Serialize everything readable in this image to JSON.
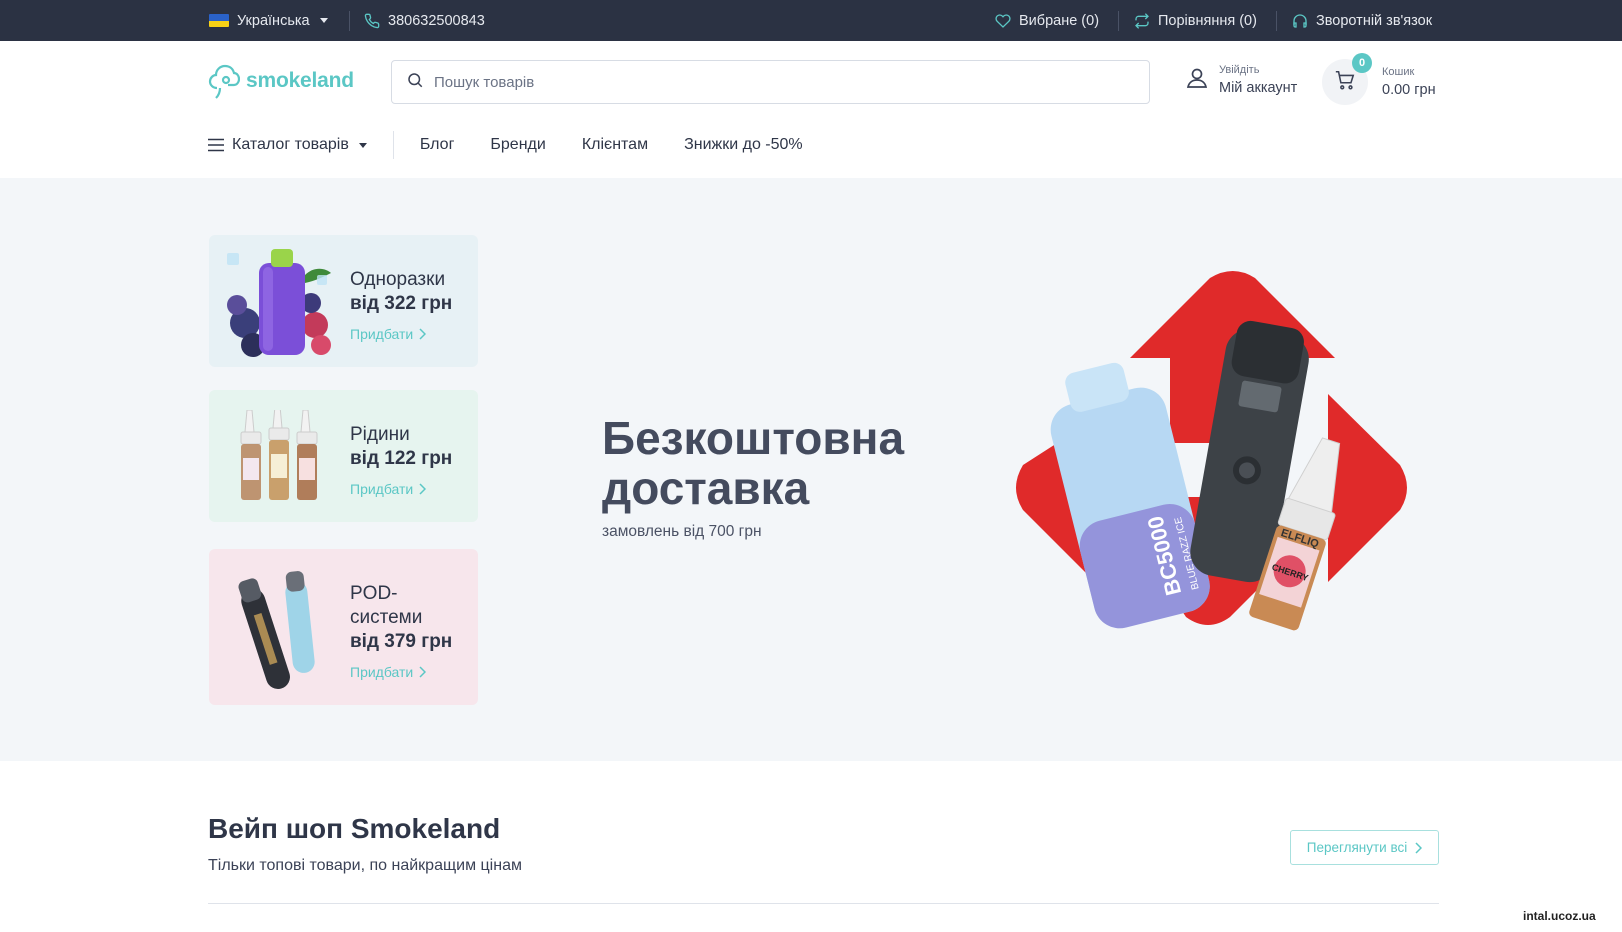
{
  "topbar": {
    "language": "Українська",
    "phone": "380632500843",
    "favorites": "Вибране (0)",
    "compare": "Порівняння (0)",
    "feedback": "Зворотній зв'язок"
  },
  "header": {
    "logo": "smokeland",
    "search_placeholder": "Пошук товарів",
    "account_small": "Увійдіть",
    "account_big": "Мій аккаунт",
    "cart_small": "Кошик",
    "cart_total": "0.00 грн",
    "cart_count": "0"
  },
  "nav": {
    "catalog": "Каталог товарів",
    "links": [
      "Блог",
      "Бренди",
      "Клієнтам",
      "Знижки до -50%"
    ]
  },
  "hero": {
    "cards": [
      {
        "name": "Одноразки",
        "price": "від 322 грн",
        "buy": "Придбати",
        "bg": "#e7f1f5"
      },
      {
        "name": "Рідини",
        "price": "від 122 грн",
        "buy": "Придбати",
        "bg": "#e6f4ef"
      },
      {
        "name_line1": "POD-",
        "name_line2": "системи",
        "price": "від 379 грн",
        "buy": "Придбати",
        "bg": "#f7e6ec"
      }
    ],
    "title_line1": "Безкоштовна",
    "title_line2": "доставка",
    "subtitle": "замовлень від 700 грн",
    "product_labels": {
      "disposable": "BC5000",
      "disposable_flavor": "BLUE RAZZ ICE",
      "liquid_brand": "ELFLIQ",
      "liquid_flavor": "CHERRY"
    }
  },
  "section": {
    "title": "Вейп шоп Smokeland",
    "subtitle": "Тільки топові товари, по найкращим цінам",
    "view_all": "Переглянути всі"
  },
  "watermark": "intal.ucoz.ua",
  "colors": {
    "accent": "#5bc7c5",
    "topbar": "#2b3243",
    "hero_bg": "#f3f6f9",
    "red": "#e02a2a"
  }
}
